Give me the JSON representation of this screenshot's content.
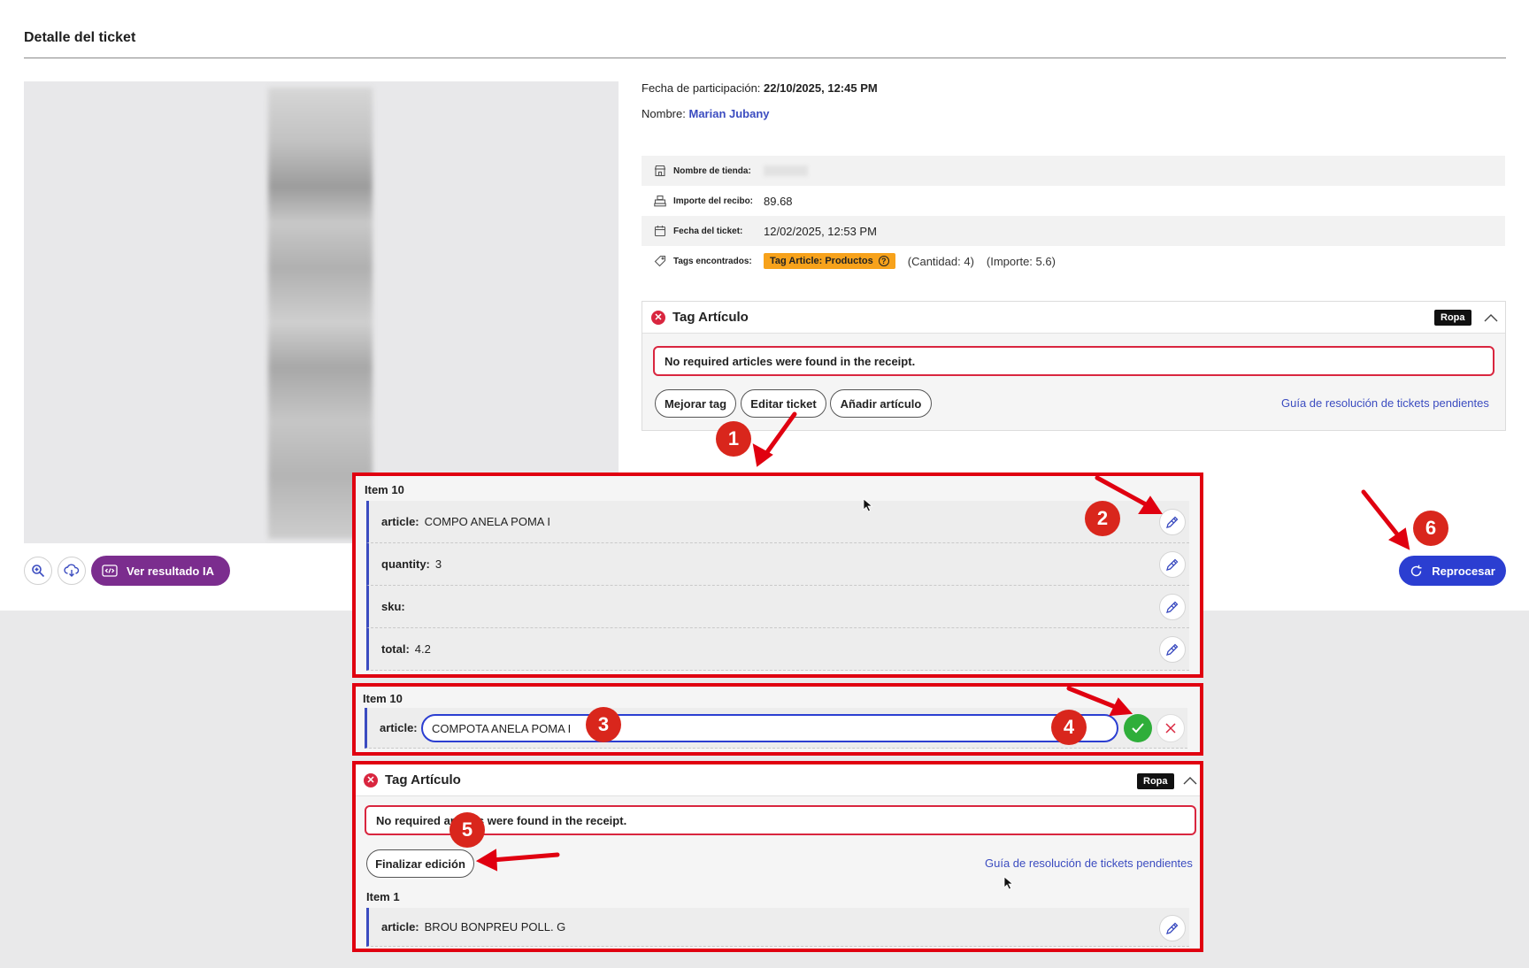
{
  "page": {
    "title": "Detalle del ticket"
  },
  "viewer": {
    "ai_button": "Ver resultado IA"
  },
  "participation": {
    "date_label": "Fecha de participación:",
    "date_value": "22/10/2025, 12:45 PM",
    "name_label": "Nombre:",
    "name_value": "Marian Jubany"
  },
  "info": {
    "store_label": "Nombre de tienda:",
    "amount_label": "Importe del recibo:",
    "amount_value": "89.68",
    "date_label": "Fecha del ticket:",
    "date_value": "12/02/2025, 12:53 PM",
    "tags_label": "Tags encontrados:",
    "tag_badge": "Tag Article: Productos",
    "tag_help": "?",
    "cantidad": "(Cantidad: 4)",
    "importe": "(Importe: 5.6)"
  },
  "tag_card": {
    "title": "Tag Artículo",
    "badge": "Ropa",
    "error": "No required articles were found in the receipt.",
    "btn_improve": "Mejorar tag",
    "btn_edit": "Editar ticket",
    "btn_add": "Añadir artículo",
    "guide": "Guía de resolución de tickets pendientes"
  },
  "reprocess": {
    "label": "Reprocesar"
  },
  "item_panel": {
    "title": "Item 10",
    "fields": [
      {
        "key": "article:",
        "value": "COMPO ANELA POMA I"
      },
      {
        "key": "quantity:",
        "value": "3"
      },
      {
        "key": "sku:",
        "value": ""
      },
      {
        "key": "total:",
        "value": "4.2"
      }
    ]
  },
  "edit_panel": {
    "title": "Item 10",
    "key": "article:",
    "value": "COMPOTA ANELA POMA I"
  },
  "tag_card_editing": {
    "title": "Tag Artículo",
    "badge": "Ropa",
    "error": "No required articles were found in the receipt.",
    "btn_finish": "Finalizar edición",
    "guide": "Guía de resolución de tickets pendientes",
    "item_title": "Item 1",
    "field_key": "article:",
    "field_value": "BROU BONPREU POLL. G"
  },
  "step_badges": [
    "1",
    "2",
    "3",
    "4",
    "5",
    "6"
  ],
  "colors": {
    "accent": "#2b3ed1",
    "error": "#d9263f",
    "annotation": "#e00010",
    "ai_button": "#7b2d8e",
    "tag": "#f7a21b",
    "ok": "#2fae3a"
  }
}
